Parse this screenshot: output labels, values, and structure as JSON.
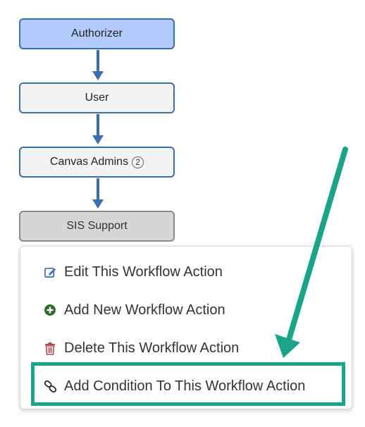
{
  "workflow": {
    "nodes": [
      {
        "label": "Authorizer"
      },
      {
        "label": "User"
      },
      {
        "label": "Canvas Admins",
        "badge": "2"
      },
      {
        "label": "SIS Support"
      }
    ]
  },
  "context_menu": {
    "items": [
      {
        "label": "Edit This Workflow Action",
        "icon": "edit-icon"
      },
      {
        "label": "Add New Workflow Action",
        "icon": "plus-circle-icon"
      },
      {
        "label": "Delete This Workflow Action",
        "icon": "trash-icon"
      },
      {
        "label": "Add Condition To This Workflow Action",
        "icon": "link-icon"
      }
    ]
  },
  "colors": {
    "accent_arrow": "#19a58a",
    "node_border": "#3a6fb0",
    "authorizer_fill": "#b3cbfc",
    "add_icon": "#2e6b2e",
    "delete_icon": "#b04a4a"
  }
}
